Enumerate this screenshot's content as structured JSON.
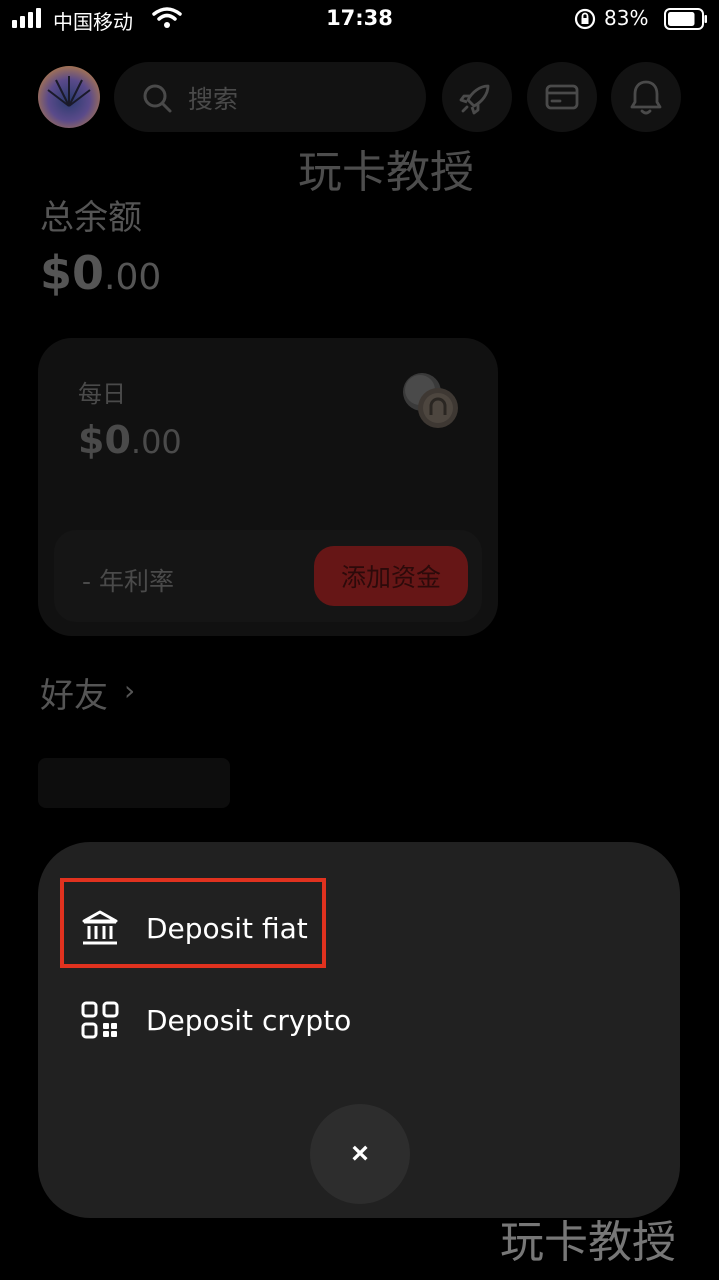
{
  "status_bar": {
    "carrier": "中国移动",
    "time": "17:38",
    "battery_percent": "83%",
    "battery_level": 0.83,
    "icons": [
      "signal-icon",
      "wifi-icon",
      "rotation-lock-icon",
      "battery-icon"
    ]
  },
  "header": {
    "search_placeholder": "搜索",
    "icons": [
      "avatar",
      "search-icon",
      "rocket-icon",
      "card-icon",
      "bell-icon"
    ]
  },
  "watermark": "玩卡教授",
  "balance": {
    "label": "总余额",
    "whole": "$0",
    "cents": ".00"
  },
  "daily_card": {
    "label": "每日",
    "whole": "$0",
    "cents": ".00",
    "apr_label": "- 年利率",
    "add_funds_label": "添加资金"
  },
  "friends": {
    "label": "好友",
    "chevron": "›"
  },
  "deposit_sheet": {
    "options": [
      {
        "label": "Deposit fiat",
        "icon": "bank-icon"
      },
      {
        "label": "Deposit crypto",
        "icon": "qr-code-icon"
      }
    ],
    "close_label": "×"
  },
  "colors": {
    "highlight_border": "#e0321f",
    "add_funds_bg": "#661616",
    "sheet_bg": "#212121"
  }
}
